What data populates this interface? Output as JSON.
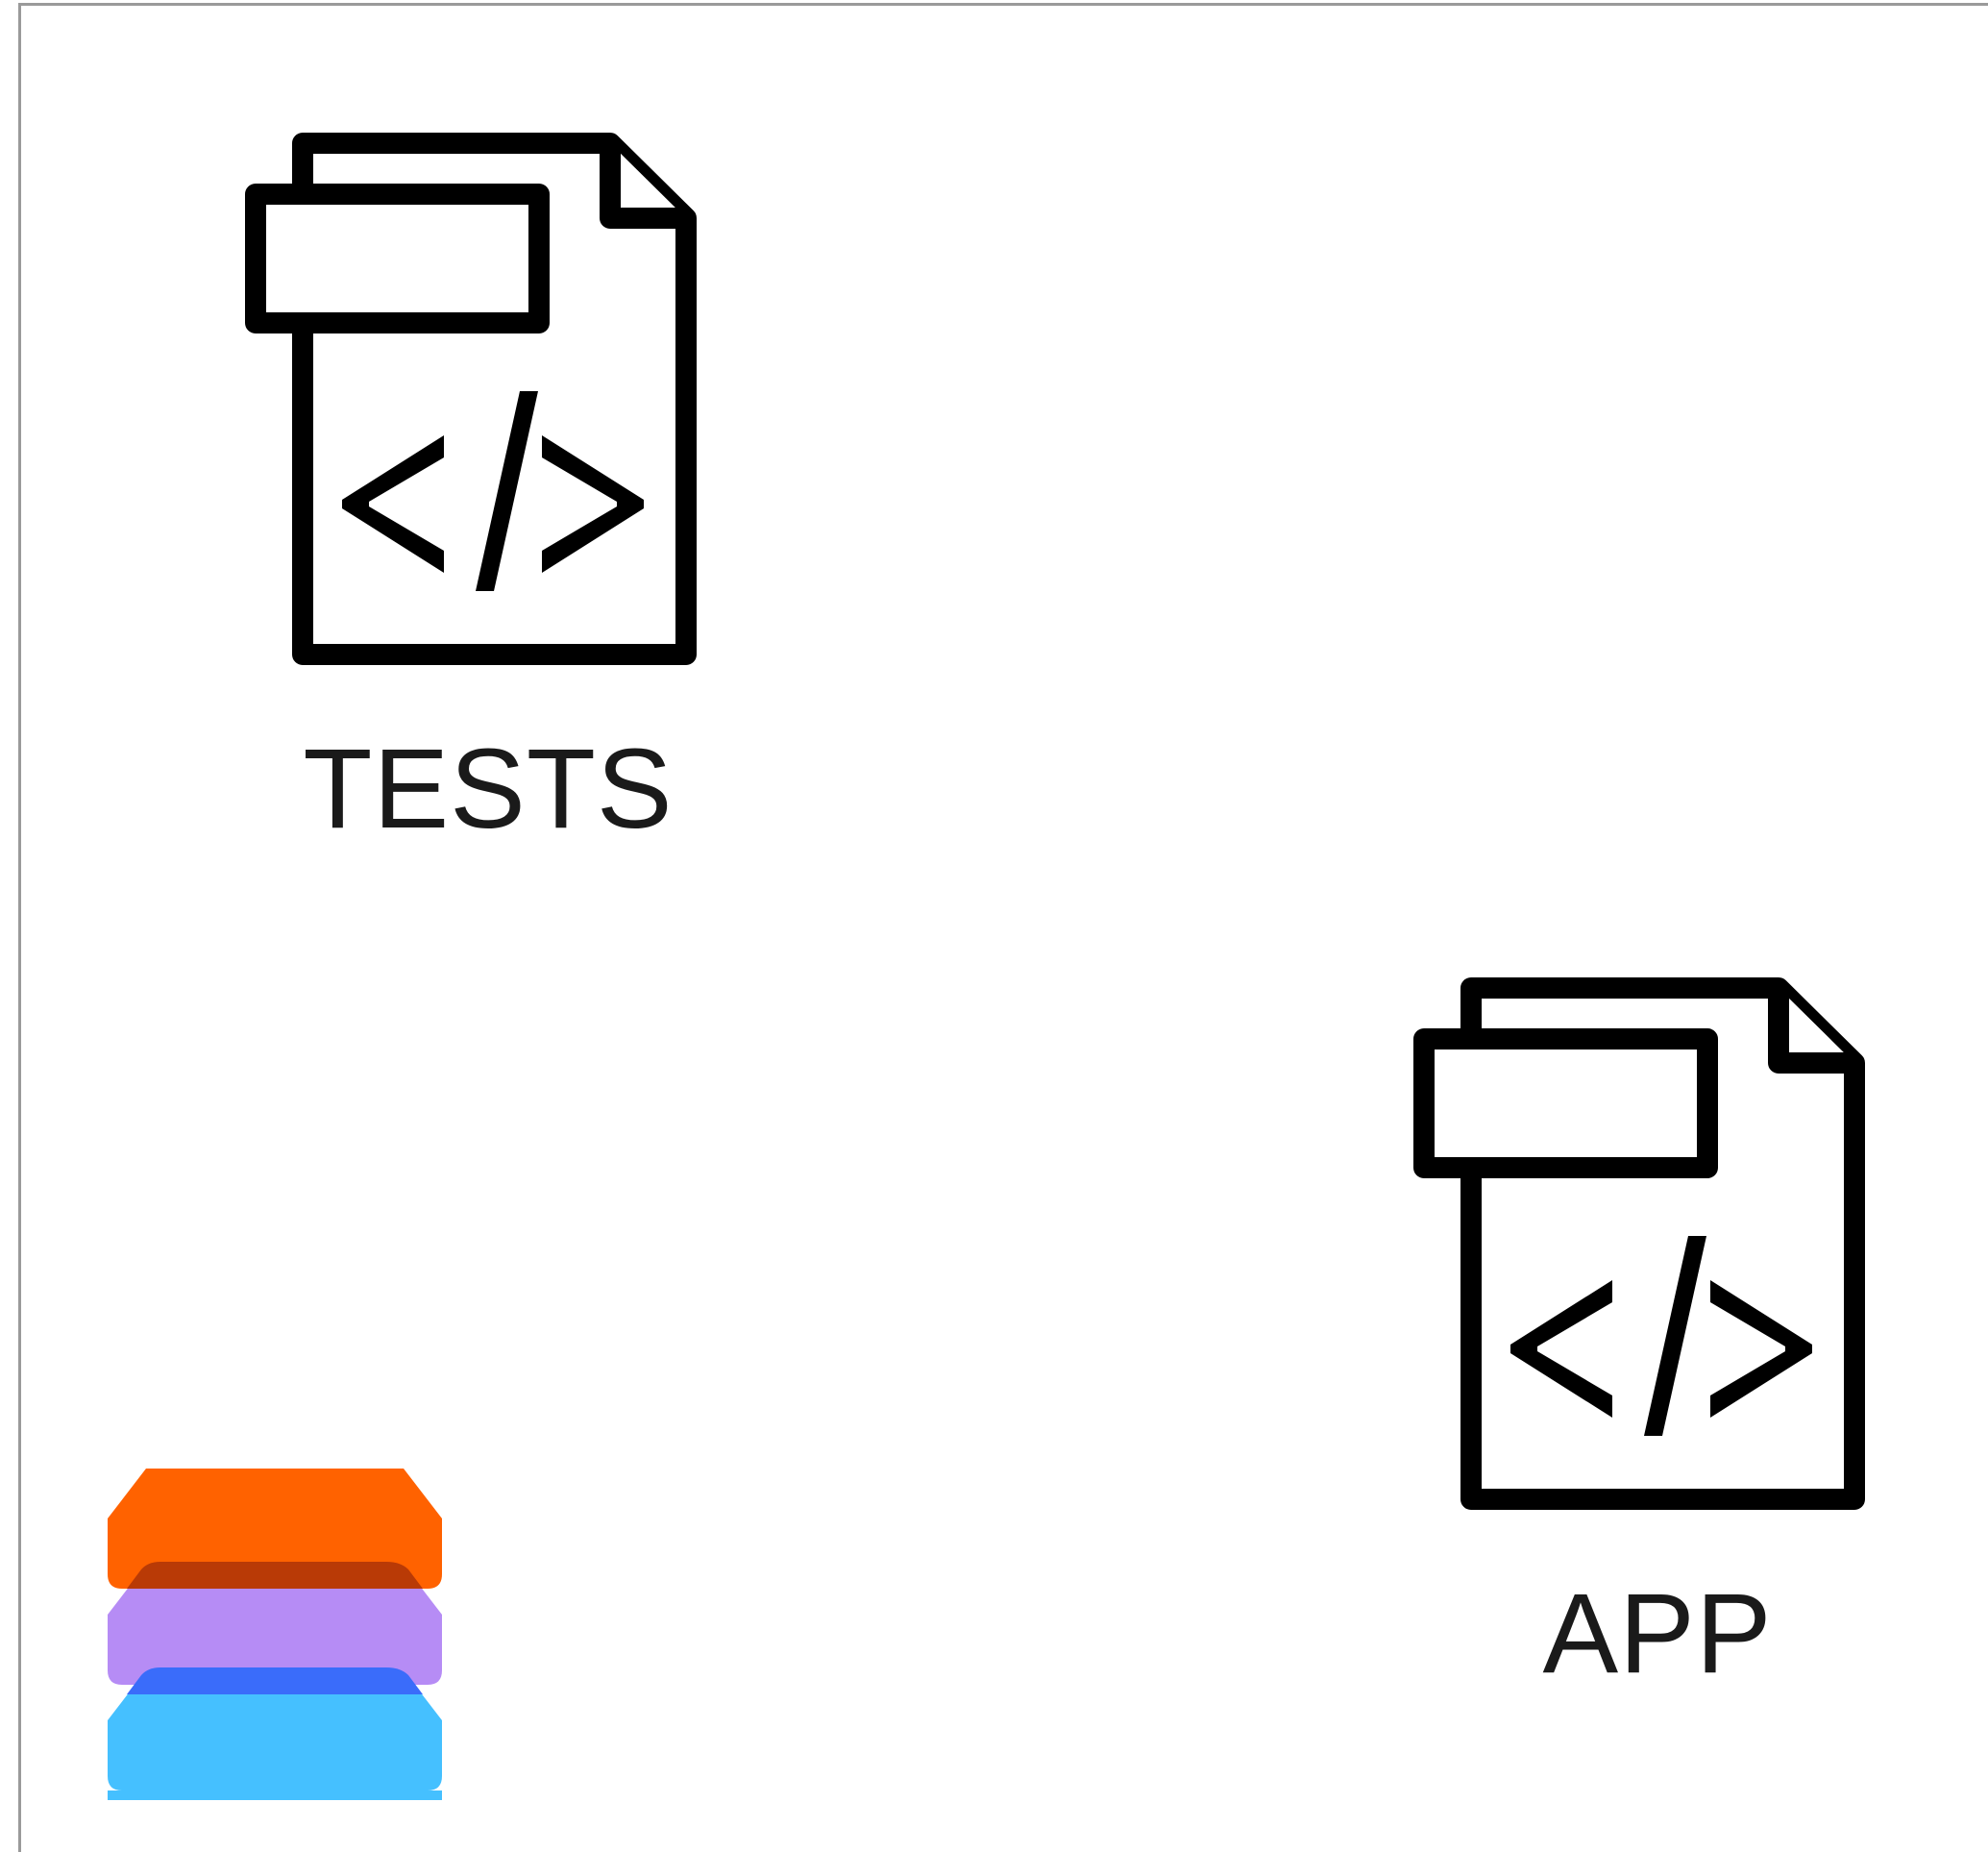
{
  "nodes": {
    "tests": {
      "label": "TESTS",
      "icon": "code-file-icon"
    },
    "app": {
      "label": "APP",
      "icon": "code-file-icon"
    }
  },
  "logo": {
    "icon": "layered-stack-logo",
    "colors": {
      "top": "#FF6200",
      "middle": "#B68CF5",
      "bottom": "#45C0FF",
      "overlap_top": "#B93A06",
      "overlap_bottom": "#3A6CFA"
    }
  },
  "colors": {
    "icon_stroke": "#000000",
    "label_text": "#1a1a1a",
    "frame_border": "#9a9a9a",
    "background": "#ffffff"
  }
}
